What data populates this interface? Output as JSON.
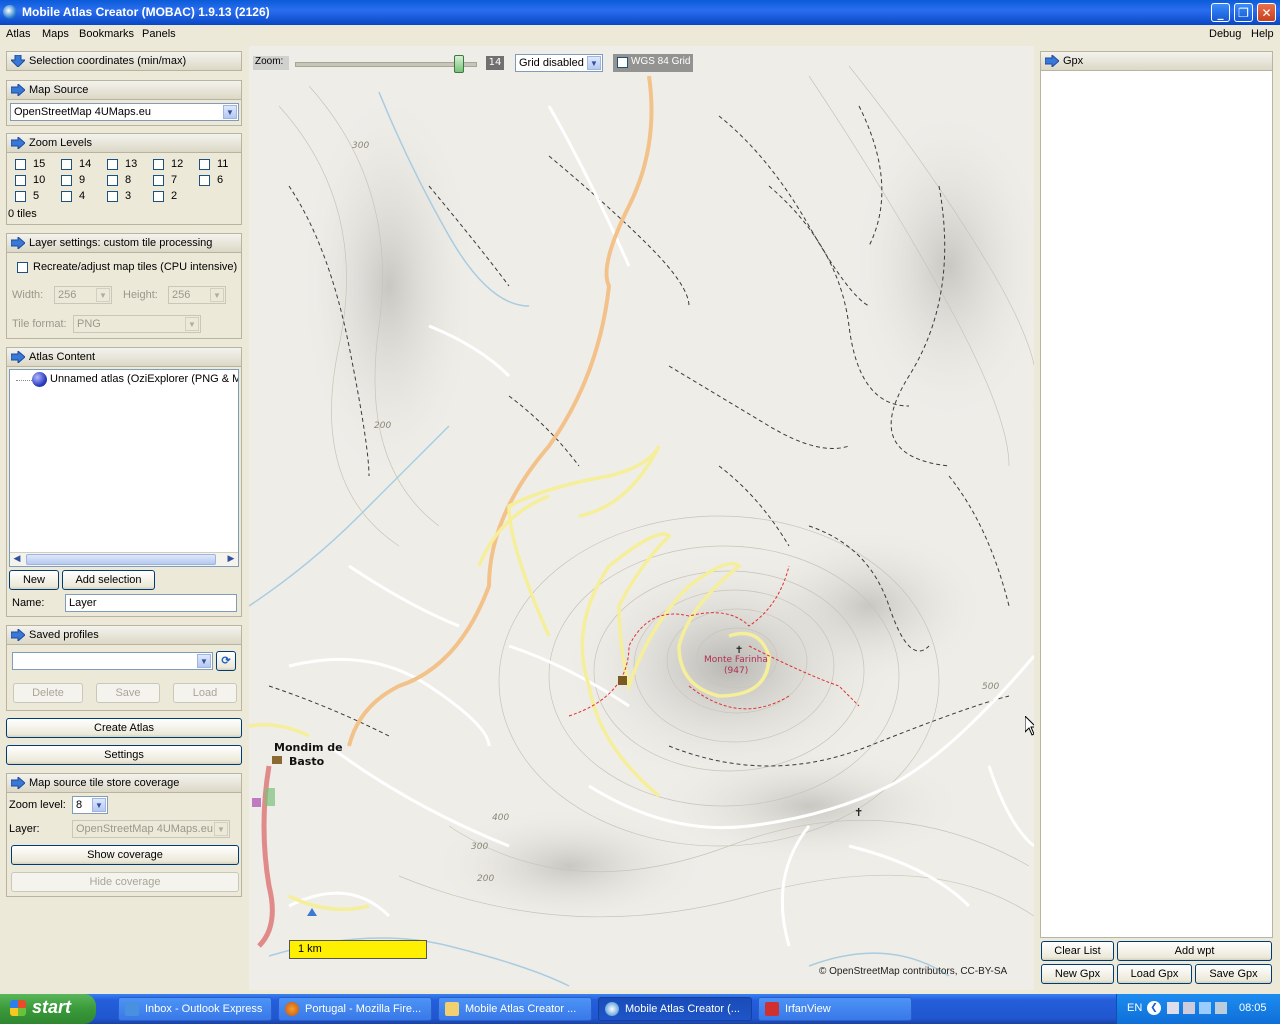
{
  "window": {
    "title": "Mobile Atlas Creator (MOBAC) 1.9.13 (2126)"
  },
  "menu": {
    "left": [
      "Atlas",
      "Maps",
      "Bookmarks",
      "Panels"
    ],
    "right": [
      "Debug",
      "Help"
    ]
  },
  "sections": {
    "selection_coords": "Selection coordinates (min/max)",
    "map_source": "Map Source",
    "zoom_levels": "Zoom Levels",
    "layer_settings": "Layer settings: custom tile processing",
    "atlas_content": "Atlas Content",
    "saved_profiles": "Saved profiles",
    "tile_store": "Map source tile store coverage",
    "gpx": "Gpx"
  },
  "map_source": {
    "selected": "OpenStreetMap 4UMaps.eu"
  },
  "zoom_levels": {
    "levels": [
      "15",
      "14",
      "13",
      "12",
      "11",
      "10",
      "9",
      "8",
      "7",
      "6",
      "5",
      "4",
      "3",
      "2"
    ],
    "tiles": "0 tiles"
  },
  "layer_settings": {
    "recreate_label": "Recreate/adjust map tiles (CPU intensive)",
    "width_label": "Width:",
    "width_value": "256",
    "height_label": "Height:",
    "height_value": "256",
    "format_label": "Tile format:",
    "format_value": "PNG"
  },
  "atlas": {
    "tree_item": "Unnamed atlas (OziExplorer (PNG & MAP",
    "new_btn": "New",
    "add_selection_btn": "Add selection",
    "name_label": "Name:",
    "name_value": "Layer"
  },
  "profiles": {
    "selected": "",
    "delete": "Delete",
    "save": "Save",
    "load": "Load"
  },
  "actions": {
    "create_atlas": "Create Atlas",
    "settings": "Settings"
  },
  "coverage": {
    "zoom_label": "Zoom level:",
    "zoom_value": "8",
    "layer_label": "Layer:",
    "layer_value": "OpenStreetMap 4UMaps.eu",
    "show": "Show coverage",
    "hide": "Hide coverage"
  },
  "map_toolbar": {
    "zoom_label": "Zoom:",
    "zoom_value": "14",
    "zoom_fraction": 0.93,
    "grid": "Grid disabled",
    "wgs_label": "WGS 84 Grid"
  },
  "map": {
    "peak_name": "Monte Farinha",
    "peak_elev": "(947)",
    "town_line1": "Mondim de",
    "town_line2": "Basto",
    "contours": [
      "300",
      "200",
      "500",
      "400",
      "300",
      "200"
    ],
    "scale": "1 km",
    "attribution": "© OpenStreetMap contributors, CC-BY-SA"
  },
  "gpx": {
    "clear_list": "Clear List",
    "add_wpt": "Add wpt",
    "new_gpx": "New Gpx",
    "load_gpx": "Load Gpx",
    "save_gpx": "Save Gpx"
  },
  "taskbar": {
    "start": "start",
    "tasks": [
      "Inbox - Outlook Express",
      "Portugal - Mozilla Fire...",
      "Mobile Atlas Creator ...",
      "Mobile Atlas Creator (...",
      "IrfanView"
    ],
    "lang": "EN",
    "clock": "08:05"
  }
}
